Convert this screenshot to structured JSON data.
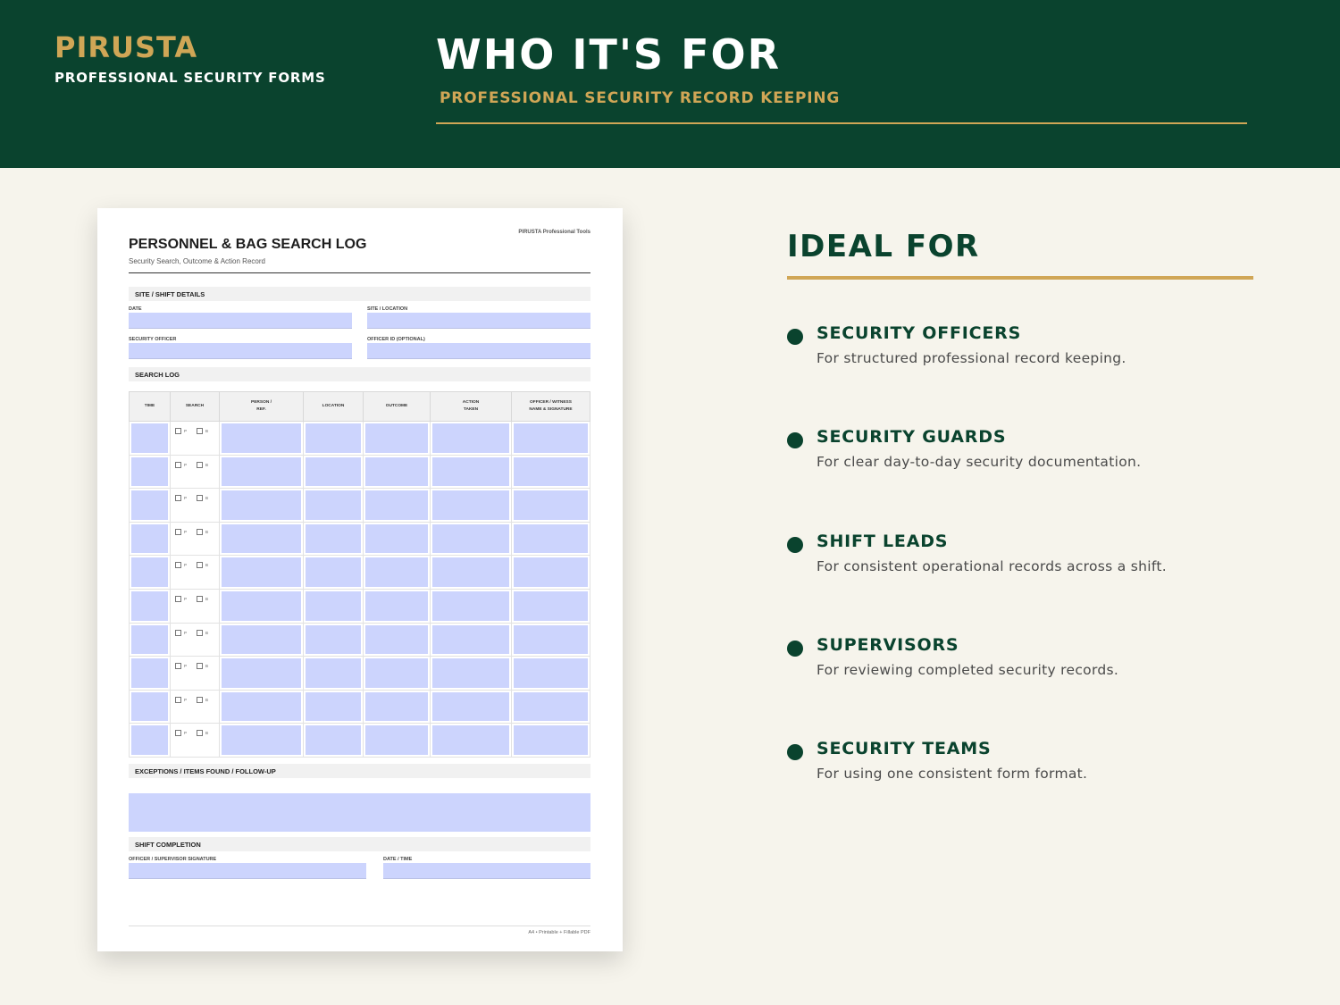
{
  "header": {
    "brand": "PIRUSTA",
    "brand_sub": "PROFESSIONAL SECURITY FORMS",
    "title": "WHO IT'S FOR",
    "subtitle": "PROFESSIONAL SECURITY RECORD KEEPING"
  },
  "document": {
    "tag": "PIRUSTA Professional Tools",
    "title": "PERSONNEL & BAG SEARCH LOG",
    "subtitle": "Security Search, Outcome & Action Record",
    "sections": {
      "site": "SITE / SHIFT DETAILS",
      "log": "SEARCH LOG",
      "exceptions": "EXCEPTIONS / ITEMS FOUND / FOLLOW-UP",
      "completion": "SHIFT COMPLETION"
    },
    "fields": {
      "date": "DATE",
      "site_location": "SITE / LOCATION",
      "security_officer": "SECURITY OFFICER",
      "officer_id": "OFFICER ID (OPTIONAL)",
      "signature": "OFFICER / SUPERVISOR SIGNATURE",
      "date_time": "DATE / TIME"
    },
    "columns": {
      "time": "TIME",
      "search": "SEARCH",
      "person_1": "PERSON /",
      "person_2": "REF.",
      "location": "LOCATION",
      "outcome": "OUTCOME",
      "action_1": "ACTION",
      "action_2": "TAKEN",
      "officer_1": "OFFICER / WITNESS",
      "officer_2": "NAME & SIGNATURE"
    },
    "checkbox_labels": {
      "p": "P",
      "b": "B"
    },
    "row_count": 10,
    "footer": "A4 • Printable + Fillable PDF"
  },
  "ideal": {
    "title": "IDEAL FOR",
    "items": [
      {
        "title": "SECURITY OFFICERS",
        "desc": "For structured professional record keeping."
      },
      {
        "title": "SECURITY GUARDS",
        "desc": "For clear day-to-day security documentation."
      },
      {
        "title": "SHIFT LEADS",
        "desc": "For consistent operational records across a shift."
      },
      {
        "title": "SUPERVISORS",
        "desc": "For reviewing completed security records."
      },
      {
        "title": "SECURITY TEAMS",
        "desc": "For using one consistent form format."
      }
    ]
  },
  "colors": {
    "primary_green": "#0a432e",
    "gold": "#d0a656",
    "background": "#f6f4ec",
    "fill_field": "#ccd4fd"
  }
}
